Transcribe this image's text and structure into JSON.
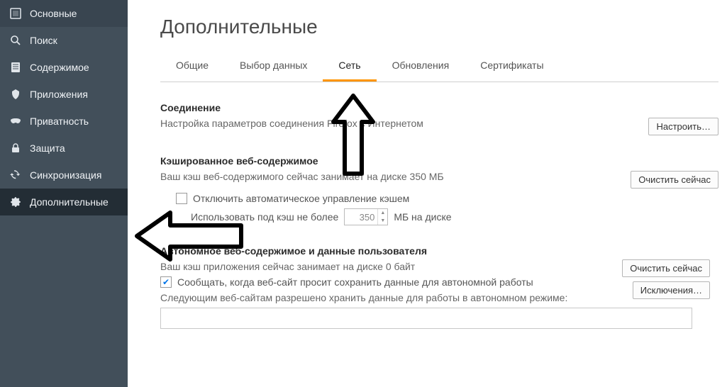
{
  "sidebar": {
    "items": [
      {
        "label": "Основные"
      },
      {
        "label": "Поиск"
      },
      {
        "label": "Содержимое"
      },
      {
        "label": "Приложения"
      },
      {
        "label": "Приватность"
      },
      {
        "label": "Защита"
      },
      {
        "label": "Синхронизация"
      },
      {
        "label": "Дополнительные"
      }
    ]
  },
  "page": {
    "title": "Дополнительные"
  },
  "tabs": [
    {
      "label": "Общие"
    },
    {
      "label": "Выбор данных"
    },
    {
      "label": "Сеть"
    },
    {
      "label": "Обновления"
    },
    {
      "label": "Сертификаты"
    }
  ],
  "connection": {
    "title": "Соединение",
    "desc": "Настройка параметров соединения Firefox с Интернетом",
    "configure_btn": "Настроить…"
  },
  "cache": {
    "title": "Кэшированное веб-содержимое",
    "desc": "Ваш кэш веб-содержимого сейчас занимает на диске 350 МБ",
    "clear_btn": "Очистить сейчас",
    "disable_label": "Отключить автоматическое управление кэшем",
    "use_label_pre": "Использовать под кэш не более",
    "use_value": "350",
    "use_label_post": "МБ на диске"
  },
  "offline": {
    "title": "Автономное веб-содержимое и данные пользователя",
    "desc": "Ваш кэш приложения сейчас занимает на диске 0 байт",
    "clear_btn": "Очистить сейчас",
    "notify_label": "Сообщать, когда веб-сайт просит сохранить данные для автономной работы",
    "exceptions_btn": "Исключения…",
    "allowed_label": "Следующим веб-сайтам разрешено хранить данные для работы в автономном режиме:"
  }
}
